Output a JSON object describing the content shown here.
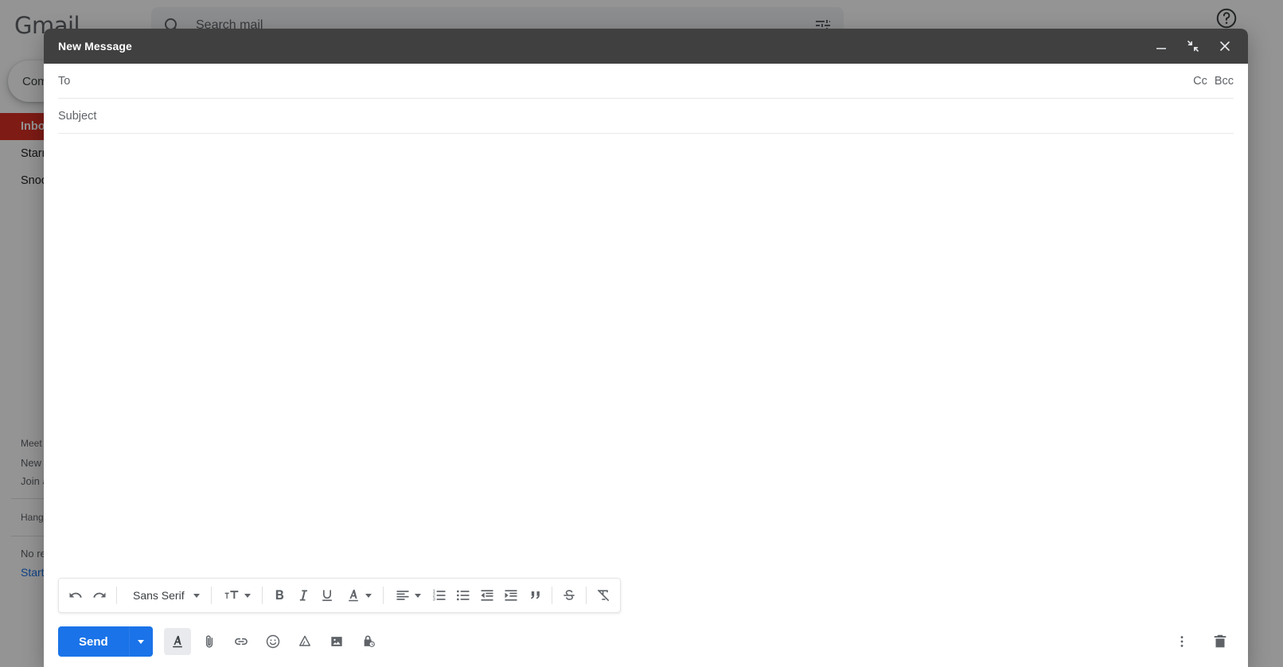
{
  "app": {
    "logo": "Gmail",
    "search": {
      "placeholder": "Search mail",
      "icon": "search-icon",
      "filter_icon": "tune-icon"
    },
    "help_icon": "help-icon",
    "compose_label": "Compose",
    "nav_items": [
      {
        "label": "Inbox",
        "selected": true
      },
      {
        "label": "Starred",
        "selected": false
      },
      {
        "label": "Snoozed",
        "selected": false
      }
    ],
    "meet": {
      "title": "Meet",
      "new_meeting": "New meeting",
      "join_meeting": "Join a meeting",
      "hangouts_label": "Hangouts",
      "no_recent_text": "No recent chats",
      "start_link": "Start a new one"
    }
  },
  "compose": {
    "title": "New Message",
    "header_buttons": [
      {
        "name": "minimize-button",
        "icon": "minimize-icon"
      },
      {
        "name": "exit-fullscreen-button",
        "icon": "exit-fullscreen-icon"
      },
      {
        "name": "close-button",
        "icon": "close-icon"
      }
    ],
    "to": {
      "placeholder": "To",
      "value": ""
    },
    "cc_label": "Cc",
    "bcc_label": "Bcc",
    "subject": {
      "placeholder": "Subject",
      "value": ""
    },
    "body": {
      "value": ""
    },
    "toolbar": {
      "font_name": "Sans Serif",
      "buttons": [
        {
          "name": "undo-button",
          "icon": "undo-icon",
          "title": "Undo"
        },
        {
          "name": "redo-button",
          "icon": "redo-icon",
          "title": "Redo"
        },
        {
          "name": "font-family-dropdown",
          "icon": "chevron-down-icon",
          "title": "Sans Serif"
        },
        {
          "name": "font-size-dropdown",
          "icon": "font-size-icon",
          "title": "Size"
        },
        {
          "name": "bold-button",
          "icon": "bold-icon",
          "title": "Bold"
        },
        {
          "name": "italic-button",
          "icon": "italic-icon",
          "title": "Italic"
        },
        {
          "name": "underline-button",
          "icon": "underline-icon",
          "title": "Underline"
        },
        {
          "name": "text-color-dropdown",
          "icon": "text-color-icon",
          "title": "Text color"
        },
        {
          "name": "align-dropdown",
          "icon": "align-left-icon",
          "title": "Align"
        },
        {
          "name": "numbered-list-button",
          "icon": "numbered-list-icon",
          "title": "Numbered list"
        },
        {
          "name": "bulleted-list-button",
          "icon": "bulleted-list-icon",
          "title": "Bulleted list"
        },
        {
          "name": "indent-less-button",
          "icon": "indent-less-icon",
          "title": "Indent less"
        },
        {
          "name": "indent-more-button",
          "icon": "indent-more-icon",
          "title": "Indent more"
        },
        {
          "name": "quote-button",
          "icon": "quote-icon",
          "title": "Quote"
        },
        {
          "name": "strikethrough-button",
          "icon": "strikethrough-icon",
          "title": "Strikethrough"
        },
        {
          "name": "remove-formatting-button",
          "icon": "remove-formatting-icon",
          "title": "Remove formatting"
        }
      ]
    },
    "actions": {
      "send_label": "Send",
      "send_options_icon": "chevron-down-icon",
      "icons": [
        {
          "name": "formatting-options-button",
          "icon": "text-format-icon",
          "active": true
        },
        {
          "name": "attach-file-button",
          "icon": "paperclip-icon",
          "active": false
        },
        {
          "name": "insert-link-button",
          "icon": "link-icon",
          "active": false
        },
        {
          "name": "insert-emoji-button",
          "icon": "emoji-icon",
          "active": false
        },
        {
          "name": "insert-drive-file-button",
          "icon": "google-drive-icon",
          "active": false
        },
        {
          "name": "insert-photo-button",
          "icon": "photo-icon",
          "active": false
        },
        {
          "name": "confidential-mode-button",
          "icon": "lock-clock-icon",
          "active": false
        }
      ],
      "more_options_icon": "more-vert-icon",
      "discard_icon": "trash-icon"
    }
  },
  "colors": {
    "accent": "#1a73e8",
    "header_bg": "#404040",
    "selected_nav": "#d93025",
    "icon_gray": "#5f6368"
  }
}
